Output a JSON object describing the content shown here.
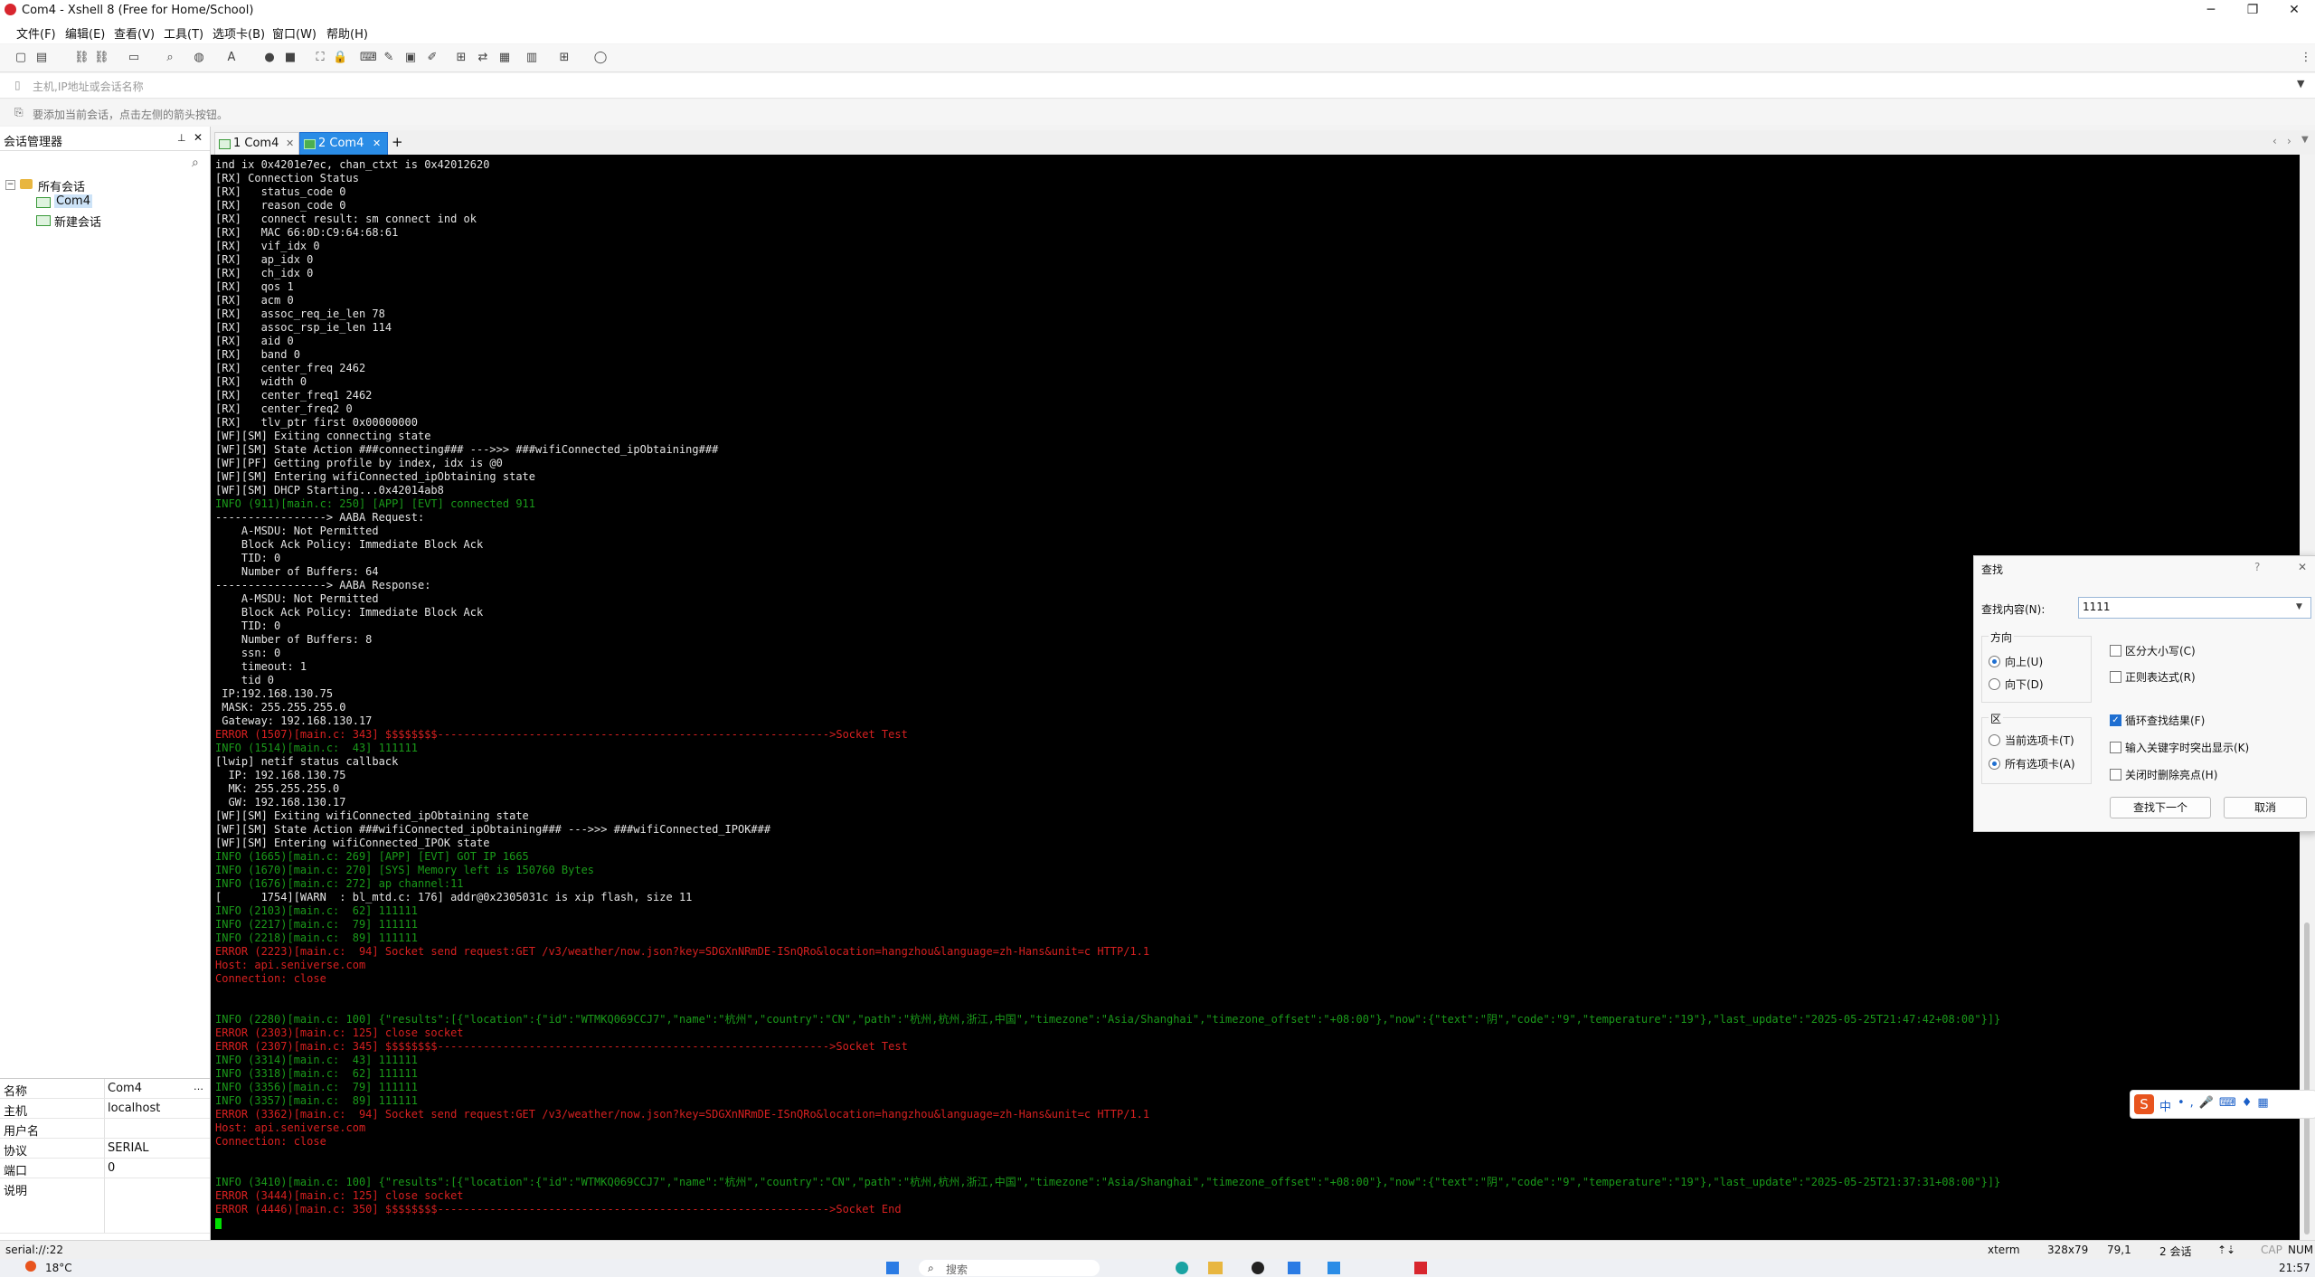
{
  "window": {
    "title": "Com4 - Xshell 8 (Free for Home/School)",
    "minimize": "─",
    "maximize": "❐",
    "close": "✕"
  },
  "menu": [
    "文件(F)",
    "编辑(E)",
    "查看(V)",
    "工具(T)",
    "选项卡(B)",
    "窗口(W)",
    "帮助(H)"
  ],
  "address": {
    "placeholder": "主机,IP地址或会话名称"
  },
  "hint": "要添加当前会话，点击左侧的箭头按钮。",
  "session_manager": {
    "title": "会话管理器",
    "pin": "📌",
    "close": "✕",
    "search_icon": "⌕",
    "tree": [
      {
        "label": "所有会话",
        "level": 0,
        "icon": "folder"
      },
      {
        "label": "Com4",
        "level": 1,
        "icon": "session",
        "selected": true
      },
      {
        "label": "新建会话",
        "level": 1,
        "icon": "session"
      }
    ],
    "properties": [
      {
        "key": "名称",
        "value": "Com4"
      },
      {
        "key": "主机",
        "value": "localhost"
      },
      {
        "key": "用户名",
        "value": ""
      },
      {
        "key": "协议",
        "value": "SERIAL"
      },
      {
        "key": "端口",
        "value": "0"
      },
      {
        "key": "说明",
        "value": ""
      }
    ]
  },
  "tabs": [
    {
      "label": "1 Com4",
      "active": false
    },
    {
      "label": "2 Com4",
      "active": true
    }
  ],
  "tab_add": "+",
  "terminal_lines": [
    {
      "t": "ind ix 0x4201e7ec, chan_ctxt is 0x42012620",
      "c": "white"
    },
    {
      "t": "[RX] Connection Status",
      "c": "white"
    },
    {
      "t": "[RX]   status_code 0",
      "c": "white"
    },
    {
      "t": "[RX]   reason_code 0",
      "c": "white"
    },
    {
      "t": "[RX]   connect result: sm connect ind ok",
      "c": "white"
    },
    {
      "t": "[RX]   MAC 66:0D:C9:64:68:61",
      "c": "white"
    },
    {
      "t": "[RX]   vif_idx 0",
      "c": "white"
    },
    {
      "t": "[RX]   ap_idx 0",
      "c": "white"
    },
    {
      "t": "[RX]   ch_idx 0",
      "c": "white"
    },
    {
      "t": "[RX]   qos 1",
      "c": "white"
    },
    {
      "t": "[RX]   acm 0",
      "c": "white"
    },
    {
      "t": "[RX]   assoc_req_ie_len 78",
      "c": "white"
    },
    {
      "t": "[RX]   assoc_rsp_ie_len 114",
      "c": "white"
    },
    {
      "t": "[RX]   aid 0",
      "c": "white"
    },
    {
      "t": "[RX]   band 0",
      "c": "white"
    },
    {
      "t": "[RX]   center_freq 2462",
      "c": "white"
    },
    {
      "t": "[RX]   width 0",
      "c": "white"
    },
    {
      "t": "[RX]   center_freq1 2462",
      "c": "white"
    },
    {
      "t": "[RX]   center_freq2 0",
      "c": "white"
    },
    {
      "t": "[RX]   tlv_ptr first 0x00000000",
      "c": "white"
    },
    {
      "t": "[WF][SM] Exiting connecting state",
      "c": "white"
    },
    {
      "t": "[WF][SM] State Action ###connecting### --->>> ###wifiConnected_ipObtaining###",
      "c": "white"
    },
    {
      "t": "[WF][PF] Getting profile by index, idx is @0",
      "c": "white"
    },
    {
      "t": "[WF][SM] Entering wifiConnected_ipObtaining state",
      "c": "white"
    },
    {
      "t": "[WF][SM] DHCP Starting...0x42014ab8",
      "c": "white"
    },
    {
      "t": "INFO (911)[main.c: 250] [APP] [EVT] connected 911",
      "c": "green"
    },
    {
      "t": "-----------------> AABA Request:",
      "c": "white"
    },
    {
      "t": "    A-MSDU: Not Permitted",
      "c": "white"
    },
    {
      "t": "    Block Ack Policy: Immediate Block Ack",
      "c": "white"
    },
    {
      "t": "    TID: 0",
      "c": "white"
    },
    {
      "t": "    Number of Buffers: 64",
      "c": "white"
    },
    {
      "t": "-----------------> AABA Response:",
      "c": "white"
    },
    {
      "t": "    A-MSDU: Not Permitted",
      "c": "white"
    },
    {
      "t": "    Block Ack Policy: Immediate Block Ack",
      "c": "white"
    },
    {
      "t": "    TID: 0",
      "c": "white"
    },
    {
      "t": "    Number of Buffers: 8",
      "c": "white"
    },
    {
      "t": "    ssn: 0",
      "c": "white"
    },
    {
      "t": "    timeout: 1",
      "c": "white"
    },
    {
      "t": "    tid 0",
      "c": "white"
    },
    {
      "t": " IP:192.168.130.75",
      "c": "white"
    },
    {
      "t": " MASK: 255.255.255.0",
      "c": "white"
    },
    {
      "t": " Gateway: 192.168.130.17",
      "c": "white"
    },
    {
      "t": "ERROR (1507)[main.c: 343] $$$$$$$$------------------------------------------------------------>Socket Test",
      "c": "red"
    },
    {
      "t": "INFO (1514)[main.c:  43] 111111",
      "c": "green"
    },
    {
      "t": "[lwip] netif status callback",
      "c": "white"
    },
    {
      "t": "  IP: 192.168.130.75",
      "c": "white"
    },
    {
      "t": "  MK: 255.255.255.0",
      "c": "white"
    },
    {
      "t": "  GW: 192.168.130.17",
      "c": "white"
    },
    {
      "t": "[WF][SM] Exiting wifiConnected_ipObtaining state",
      "c": "white"
    },
    {
      "t": "[WF][SM] State Action ###wifiConnected_ipObtaining### --->>> ###wifiConnected_IPOK###",
      "c": "white"
    },
    {
      "t": "[WF][SM] Entering wifiConnected_IPOK state",
      "c": "white"
    },
    {
      "t": "INFO (1665)[main.c: 269] [APP] [EVT] GOT IP 1665",
      "c": "green"
    },
    {
      "t": "INFO (1670)[main.c: 270] [SYS] Memory left is 150760 Bytes",
      "c": "green"
    },
    {
      "t": "INFO (1676)[main.c: 272] ap channel:11",
      "c": "green"
    },
    {
      "t": "[      1754][WARN  : bl_mtd.c: 176] addr@0x2305031c is xip flash, size 11",
      "c": "white"
    },
    {
      "t": "INFO (2103)[main.c:  62] 111111",
      "c": "green"
    },
    {
      "t": "INFO (2217)[main.c:  79] 111111",
      "c": "green"
    },
    {
      "t": "INFO (2218)[main.c:  89] 111111",
      "c": "green"
    },
    {
      "t": "ERROR (2223)[main.c:  94] Socket send request:GET /v3/weather/now.json?key=SDGXnNRmDE-ISnQRo&location=hangzhou&language=zh-Hans&unit=c HTTP/1.1",
      "c": "red"
    },
    {
      "t": "Host: api.seniverse.com",
      "c": "red"
    },
    {
      "t": "Connection: close",
      "c": "red"
    },
    {
      "t": "",
      "c": "white"
    },
    {
      "t": "",
      "c": "white"
    },
    {
      "t": "INFO (2280)[main.c: 100] {\"results\":[{\"location\":{\"id\":\"WTMKQ069CCJ7\",\"name\":\"杭州\",\"country\":\"CN\",\"path\":\"杭州,杭州,浙江,中国\",\"timezone\":\"Asia/Shanghai\",\"timezone_offset\":\"+08:00\"},\"now\":{\"text\":\"阴\",\"code\":\"9\",\"temperature\":\"19\"},\"last_update\":\"2025-05-25T21:47:42+08:00\"}]}",
      "c": "green"
    },
    {
      "t": "ERROR (2303)[main.c: 125] close socket",
      "c": "red"
    },
    {
      "t": "ERROR (2307)[main.c: 345] $$$$$$$$------------------------------------------------------------>Socket Test",
      "c": "red"
    },
    {
      "t": "INFO (3314)[main.c:  43] 111111",
      "c": "green"
    },
    {
      "t": "INFO (3318)[main.c:  62] 111111",
      "c": "green"
    },
    {
      "t": "INFO (3356)[main.c:  79] 111111",
      "c": "green"
    },
    {
      "t": "INFO (3357)[main.c:  89] 111111",
      "c": "green"
    },
    {
      "t": "ERROR (3362)[main.c:  94] Socket send request:GET /v3/weather/now.json?key=SDGXnNRmDE-ISnQRo&location=hangzhou&language=zh-Hans&unit=c HTTP/1.1",
      "c": "red"
    },
    {
      "t": "Host: api.seniverse.com",
      "c": "red"
    },
    {
      "t": "Connection: close",
      "c": "red"
    },
    {
      "t": "",
      "c": "white"
    },
    {
      "t": "",
      "c": "white"
    },
    {
      "t": "INFO (3410)[main.c: 100] {\"results\":[{\"location\":{\"id\":\"WTMKQ069CCJ7\",\"name\":\"杭州\",\"country\":\"CN\",\"path\":\"杭州,杭州,浙江,中国\",\"timezone\":\"Asia/Shanghai\",\"timezone_offset\":\"+08:00\"},\"now\":{\"text\":\"阴\",\"code\":\"9\",\"temperature\":\"19\"},\"last_update\":\"2025-05-25T21:37:31+08:00\"}]}",
      "c": "green"
    },
    {
      "t": "ERROR (3444)[main.c: 125] close socket",
      "c": "red"
    },
    {
      "t": "ERROR (4446)[main.c: 350] $$$$$$$$------------------------------------------------------------>Socket End",
      "c": "red"
    }
  ],
  "colors": {
    "white": "#e4e4e4",
    "green": "#1a9a1a",
    "red": "#d62020",
    "accent": "#1f6fd1"
  },
  "find_dialog": {
    "title": "查找",
    "help": "?",
    "close": "✕",
    "find_label": "查找内容(N):",
    "find_value": "1111",
    "direction_label": "方向",
    "up": "向上(U)",
    "down": "向下(D)",
    "up_selected": true,
    "scope_label": "区",
    "current_tab": "当前选项卡(T)",
    "all_tabs": "所有选项卡(A)",
    "all_tabs_selected": true,
    "opt_case": "区分大小写(C)",
    "opt_regex": "正则表达式(R)",
    "opt_wrap": "循环查找结果(F)",
    "opt_highlight": "输入关键字时突出显示(K)",
    "opt_clear": "关闭时删除亮点(H)",
    "find_next": "查找下一个",
    "cancel": "取消"
  },
  "status": {
    "path": "serial://:22",
    "term": "xterm",
    "size": "328x79",
    "pos": "79,1",
    "sessions": "2 会话",
    "caps": "CAP",
    "num": "NUM"
  },
  "taskbar": {
    "weather": "18°C",
    "time": "21:57",
    "search": "搜索"
  },
  "ime": {
    "label": "中"
  }
}
